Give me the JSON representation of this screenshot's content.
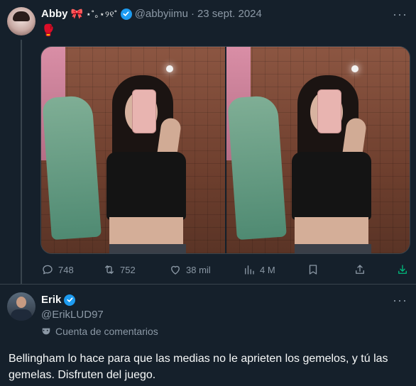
{
  "tweet": {
    "author_name": "Abby",
    "name_emoji": "🎀",
    "name_deco": "⋆˚｡⋆୨୧˚",
    "handle": "@abbyiimu",
    "separator": "·",
    "date": "23 sept. 2024",
    "text": "🥊",
    "more": "···",
    "stats": {
      "replies": "748",
      "retweets": "752",
      "likes": "38 mil",
      "views": "4 M"
    },
    "icons": [
      "reply-icon",
      "retweet-icon",
      "like-icon",
      "views-icon",
      "bookmark-icon",
      "share-icon",
      "download-icon"
    ]
  },
  "reply": {
    "author_name": "Erik",
    "handle": "@ErikLUD97",
    "account_type": "Cuenta de comentarios",
    "more": "···",
    "text": "Bellingham lo hace para que las medias no le aprieten los gemelos, y tú las gemelas. Disfruten del juego."
  },
  "colors": {
    "background": "#15202b",
    "verified": "#1d9bf0",
    "muted": "#8b98a5",
    "download_accent": "#00ba7c"
  }
}
